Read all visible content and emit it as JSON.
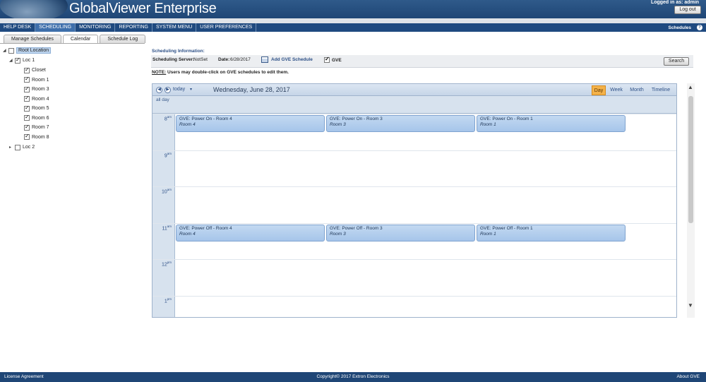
{
  "header": {
    "title": "GlobalViewer Enterprise",
    "logged_in": "Logged in as: admin",
    "logout": "Log out"
  },
  "nav": {
    "items": [
      "HELP DESK",
      "SCHEDULING",
      "MONITORING",
      "REPORTING",
      "SYSTEM MENU",
      "USER PREFERENCES"
    ],
    "active": "SCHEDULING",
    "right_label": "Schedules",
    "help": "?"
  },
  "tabs": {
    "items": [
      "Manage Schedules",
      "Calendar",
      "Schedule Log"
    ],
    "active": "Calendar"
  },
  "tree": {
    "root": "Root Location",
    "loc1": "Loc 1",
    "loc1_children": [
      "Closet",
      "Room 1",
      "Room 3",
      "Room 4",
      "Room 5",
      "Room 6",
      "Room 7",
      "Room 8"
    ],
    "loc2": "Loc 2",
    "expanded_glyph": "◢",
    "collapsed_glyph": "▸"
  },
  "schedule_info": {
    "title": "Scheduling Information:",
    "server_label": "Scheduling Server:",
    "server_value": "NotSet",
    "date_label": "Date:",
    "date_value": "6/28/2017",
    "add_label": "Add GVE Schedule",
    "gve_label": "GVE",
    "search": "Search",
    "note_prefix": "NOTE:",
    "note_text": " Users may double-click on GVE schedules to edit them."
  },
  "calendar": {
    "prev": "◀",
    "next": "▶",
    "today": "today",
    "today_caret": "▾",
    "date": "Wednesday, June 28, 2017",
    "views": [
      "Day",
      "Week",
      "Month",
      "Timeline"
    ],
    "active_view": "Day",
    "all_day": "all day",
    "hours": [
      {
        "h": "8",
        "ap": "am"
      },
      {
        "h": "9",
        "ap": "am"
      },
      {
        "h": "10",
        "ap": "am"
      },
      {
        "h": "11",
        "ap": "am"
      },
      {
        "h": "12",
        "ap": "pm"
      },
      {
        "h": "1",
        "ap": "pm"
      }
    ],
    "events": [
      {
        "title": "GVE: Power On - Room 4",
        "room": "Room 4",
        "hour": "8",
        "column": 0
      },
      {
        "title": "GVE: Power On - Room 3",
        "room": "Room 3",
        "hour": "8",
        "column": 1
      },
      {
        "title": "GVE: Power On - Room 1",
        "room": "Room 1",
        "hour": "8",
        "column": 2
      },
      {
        "title": "GVE: Power Off - Room 4",
        "room": "Room 4",
        "hour": "11",
        "column": 0
      },
      {
        "title": "GVE: Power Off - Room 3",
        "room": "Room 3",
        "hour": "11",
        "column": 1
      },
      {
        "title": "GVE: Power Off - Room 1",
        "room": "Room 1",
        "hour": "11",
        "column": 2
      }
    ]
  },
  "scrollbar": {
    "up": "▲",
    "down": "▼"
  },
  "footer": {
    "left": "License Agreement",
    "center": "Copyright© 2017 Extron Electronics",
    "right": "About GVE"
  },
  "colors": {
    "header": "#1f4676",
    "nav": "#1f4a80",
    "active_view": "#f4b24a",
    "event": "#a6c5ea"
  }
}
